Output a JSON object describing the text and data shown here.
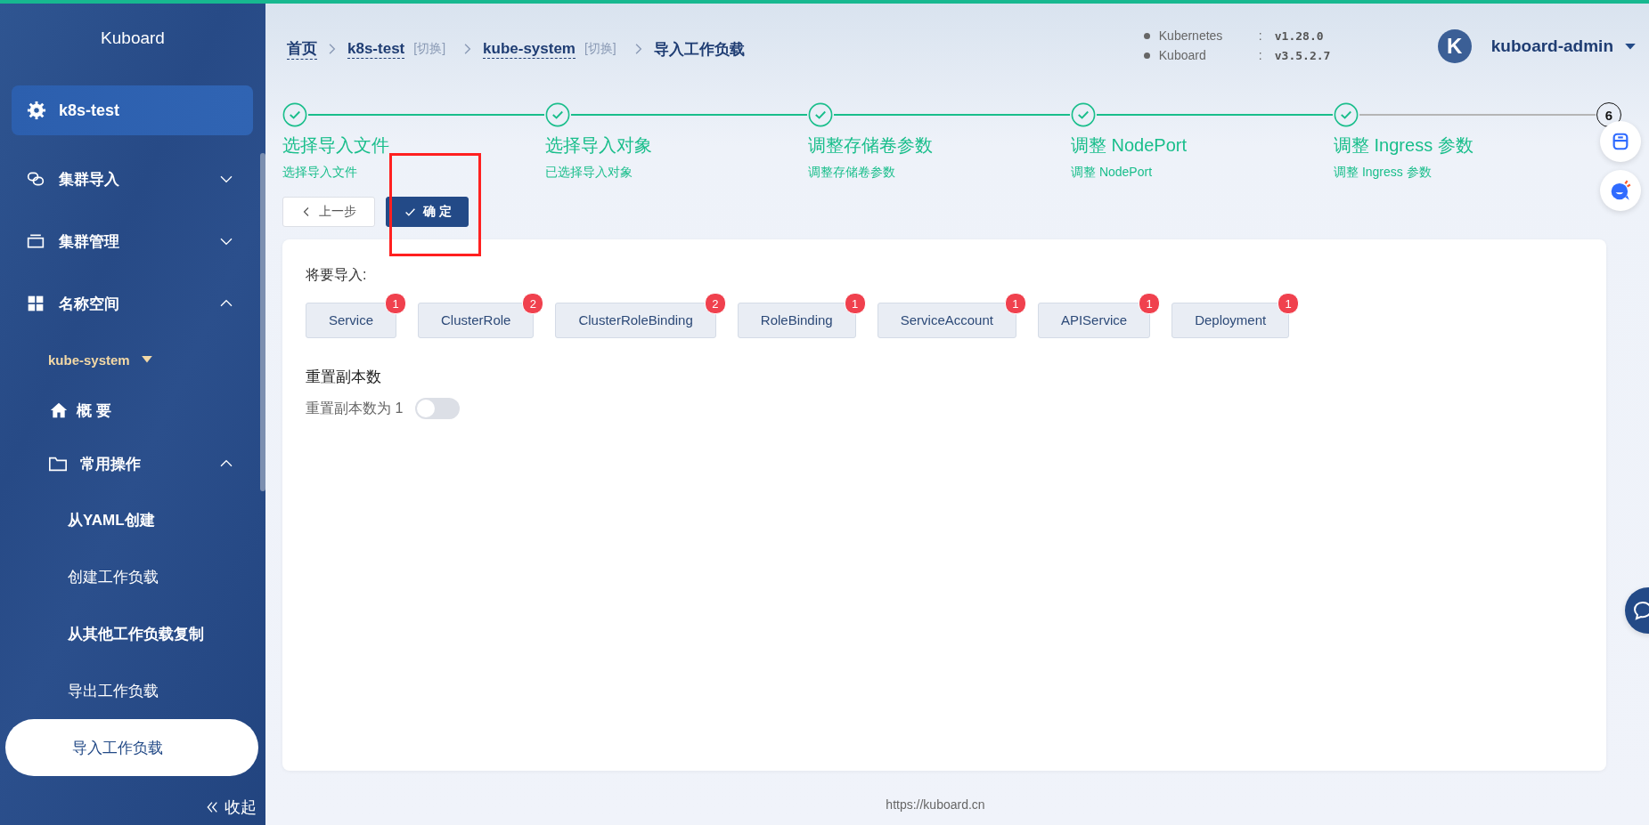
{
  "sidebar": {
    "brand": "Kuboard",
    "cluster": {
      "label": "k8s-test",
      "selected": true
    },
    "items": [
      {
        "kind": "group",
        "label": "集群导入",
        "expanded": false
      },
      {
        "kind": "group",
        "label": "集群管理",
        "expanded": false
      },
      {
        "kind": "group",
        "label": "名称空间",
        "expanded": true,
        "children": [
          {
            "kind": "namespace",
            "label": "kube-system"
          },
          {
            "kind": "link",
            "label": "概 要",
            "selected": false,
            "emphasized": true
          },
          {
            "kind": "folder",
            "label": "常用操作",
            "expanded": true,
            "children": [
              {
                "kind": "link",
                "label": "从YAML创建",
                "selected": false,
                "emphasized": true
              },
              {
                "kind": "link",
                "label": "创建工作负载",
                "selected": false,
                "emphasized": false
              },
              {
                "kind": "link",
                "label": "从其他工作负载复制",
                "selected": false,
                "emphasized": true
              },
              {
                "kind": "link",
                "label": "导出工作负载",
                "selected": false,
                "emphasized": false
              },
              {
                "kind": "link",
                "label": "导入工作负载",
                "selected": true,
                "emphasized": false
              }
            ]
          }
        ]
      }
    ],
    "collapse": "收起"
  },
  "breadcrumb": [
    {
      "kind": "link",
      "label": "首页"
    },
    {
      "kind": "link",
      "label": "k8s-test",
      "switch": "[切换]"
    },
    {
      "kind": "link",
      "label": "kube-system",
      "switch": "[切换]"
    },
    {
      "kind": "current",
      "label": "导入工作负载"
    }
  ],
  "versions": [
    {
      "name": "Kubernetes",
      "separator": ":",
      "value": "v1.28.0"
    },
    {
      "name": "Kuboard",
      "separator": ":",
      "value": "v3.5.2.7"
    }
  ],
  "user": {
    "initial": "K",
    "name": "kuboard-admin"
  },
  "steps": [
    {
      "finished": true,
      "title": "选择导入文件",
      "description": "选择导入文件"
    },
    {
      "finished": true,
      "title": "选择导入对象",
      "description": "已选择导入对象"
    },
    {
      "finished": true,
      "title": "调整存储卷参数",
      "description": "调整存储卷参数"
    },
    {
      "finished": true,
      "title": "调整 NodePort",
      "description": "调整 NodePort"
    },
    {
      "finished": true,
      "title": "调整 Ingress 参数",
      "description": "调整 Ingress 参数"
    },
    {
      "finished": false,
      "number": "6"
    }
  ],
  "actions": {
    "previous": "上一步",
    "confirm": "确 定"
  },
  "annotation": {
    "kind": "rectangle",
    "color": "#ff2020"
  },
  "import": {
    "title": "将要导入:",
    "items": [
      {
        "label": "Service",
        "count": "1"
      },
      {
        "label": "ClusterRole",
        "count": "2"
      },
      {
        "label": "ClusterRoleBinding",
        "count": "2"
      },
      {
        "label": "RoleBinding",
        "count": "1"
      },
      {
        "label": "ServiceAccount",
        "count": "1"
      },
      {
        "label": "APIService",
        "count": "1"
      },
      {
        "label": "Deployment",
        "count": "1"
      }
    ],
    "replicas": {
      "title": "重置副本数",
      "label": "重置副本数为 1",
      "on": false
    }
  },
  "footer": "https://kuboard.cn"
}
